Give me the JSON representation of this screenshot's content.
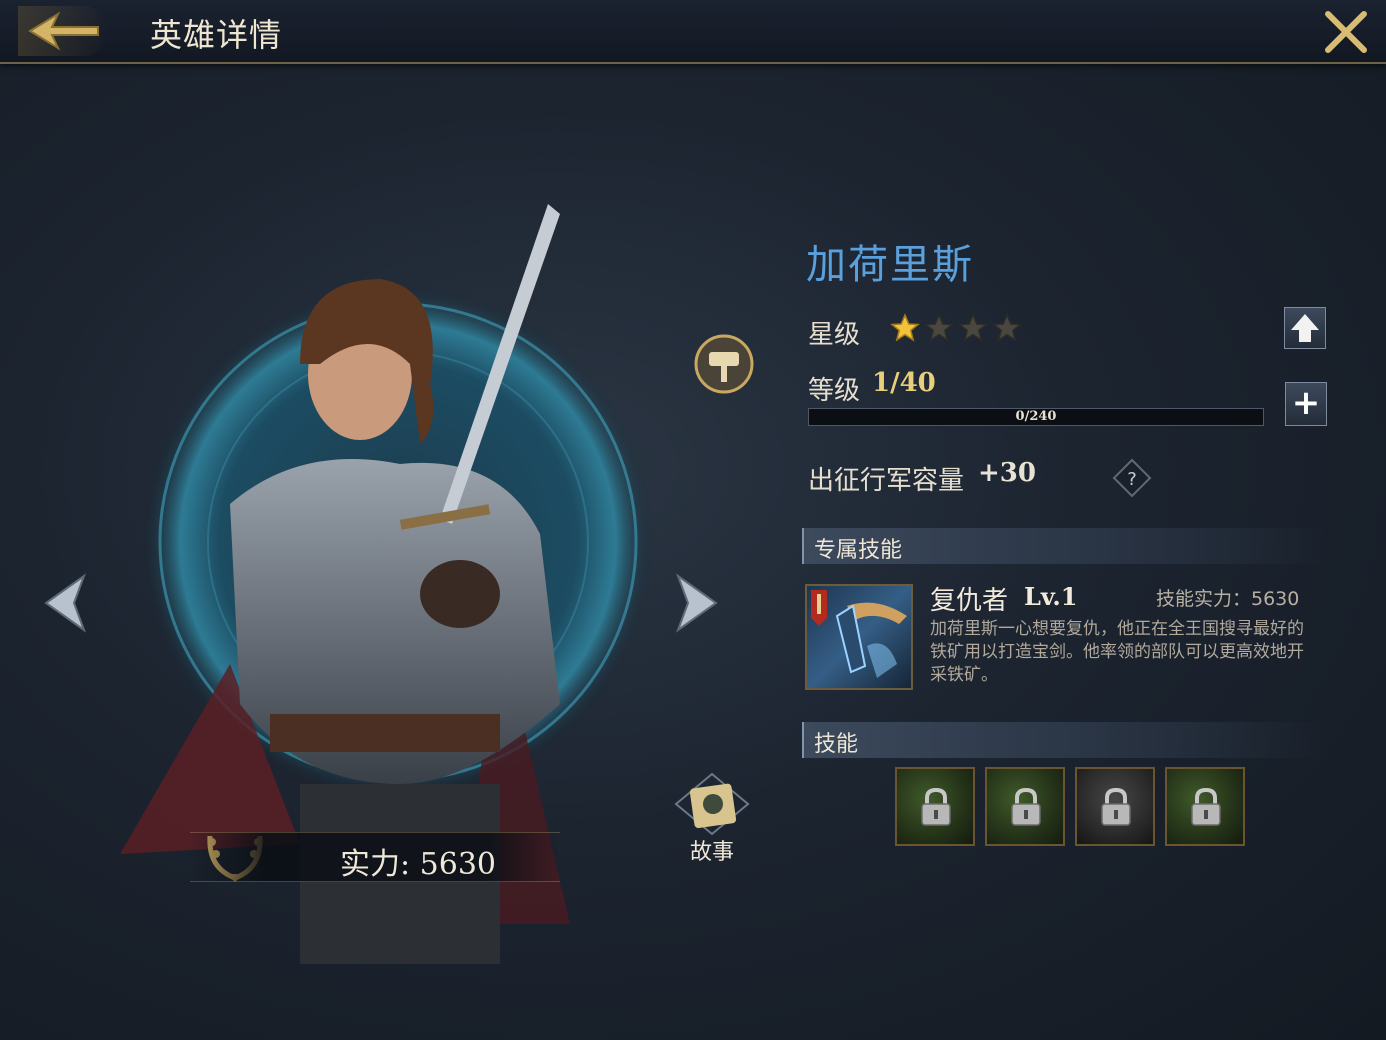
{
  "header": {
    "title": "英雄详情"
  },
  "hero": {
    "name": "加荷里斯",
    "star_label": "星级",
    "stars_filled": 1,
    "stars_total": 4,
    "level_label": "等级",
    "level_value": "1/40",
    "xp_text": "0/240",
    "xp_progress": 0,
    "march_label": "出征行军容量",
    "march_value": "+30",
    "help_symbol": "?",
    "power_text": "实力: 5630",
    "story_label": "故事"
  },
  "sections": {
    "exclusive_skill": "专属技能",
    "skills": "技能"
  },
  "exclusive_skill": {
    "name": "复仇者",
    "level": "Lv.1",
    "power": "技能实力：5630",
    "description": "加荷里斯一心想要复仇，他正在全王国搜寻最好的铁矿用以打造宝剑。他率领的部队可以更高效地开采铁矿。"
  },
  "locked_skills": [
    {
      "icon": "locked-skill-scroll-icon"
    },
    {
      "icon": "locked-skill-scroll-icon"
    },
    {
      "icon": "locked-skill-warrior-icon"
    },
    {
      "icon": "locked-skill-scroll-icon"
    }
  ],
  "colors": {
    "name": "#5aa0dc",
    "level_value": "#e8cf7a",
    "gold_accent": "#c9a860"
  }
}
